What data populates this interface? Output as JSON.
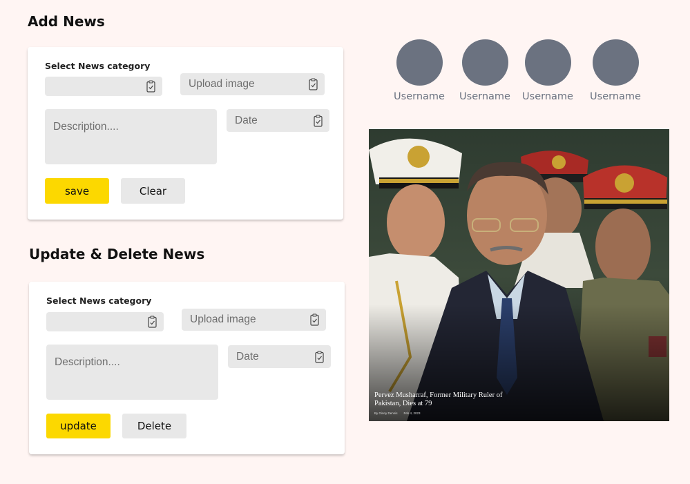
{
  "add_section": {
    "title": "Add News",
    "category_label": "Select News category",
    "category_value": "",
    "upload_placeholder": "Upload image",
    "description_placeholder": "Description....",
    "date_placeholder": "Date",
    "primary_button": "save",
    "secondary_button": "Clear"
  },
  "update_section": {
    "title": "Update & Delete News",
    "category_label": "Select News category",
    "category_value": "",
    "upload_placeholder": "Upload image",
    "description_placeholder": "Description....",
    "date_placeholder": "Date",
    "primary_button": "update",
    "secondary_button": "Delete"
  },
  "users": [
    {
      "name": "Username"
    },
    {
      "name": "Username"
    },
    {
      "name": "Username"
    },
    {
      "name": "Username"
    }
  ],
  "news_card": {
    "headline": "Pervez Musharraf, Former Military Ruler of Pakistan, Dies at 79",
    "author": "By Ginny Dennis",
    "date": "Feb 4, 2023"
  },
  "colors": {
    "background": "#fff5f3",
    "accent_yellow": "#fcd800",
    "field_gray": "#e8e8e8",
    "avatar_gray": "#6b7280"
  },
  "icons": {
    "field_icon": "clipboard-check-icon"
  }
}
